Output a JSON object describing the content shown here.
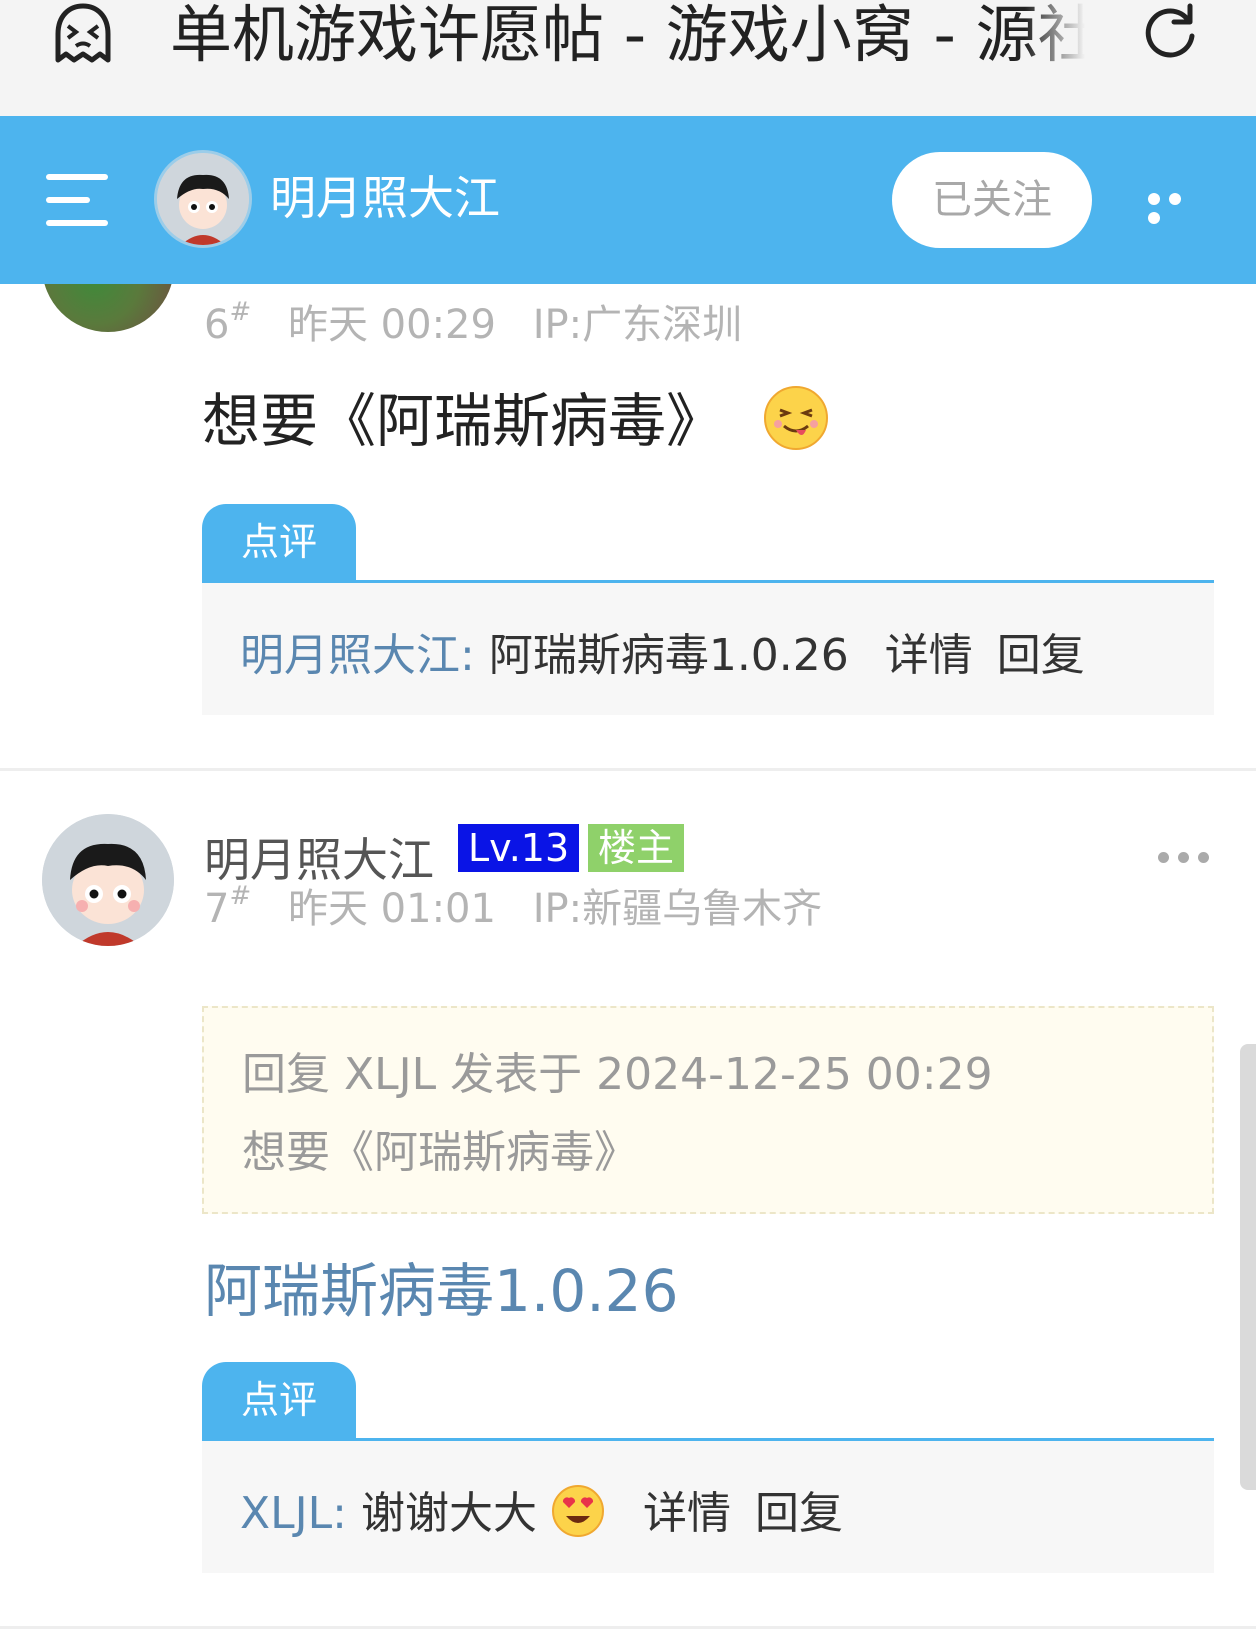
{
  "browser": {
    "title": "单机游戏许愿帖 - 游戏小窝 - 源社"
  },
  "header": {
    "name": "明月照大江",
    "follow_label": "已关注"
  },
  "posts": [
    {
      "floor": "6",
      "floor_mark": "#",
      "time": "昨天 00:29",
      "ip": "IP:广东深圳",
      "text": "想要《阿瑞斯病毒》",
      "review_tab": "点评",
      "review": {
        "user": "明月照大江:",
        "text": "阿瑞斯病毒1.0.26",
        "detail": "详情",
        "reply": "回复"
      }
    },
    {
      "username": "明月照大江",
      "level": "Lv.13",
      "role": "楼主",
      "floor": "7",
      "floor_mark": "#",
      "time": "昨天 01:01",
      "ip": "IP:新疆乌鲁木齐",
      "quote_header": "回复 XLJL 发表于 2024-12-25 00:29",
      "quote_text": "想要《阿瑞斯病毒》",
      "link_text": "阿瑞斯病毒1.0.26",
      "review_tab": "点评",
      "review": {
        "user": "XLJL:",
        "text": "谢谢大大",
        "detail": "详情",
        "reply": "回复"
      }
    }
  ],
  "colors": {
    "header_bg": "#4db4ee",
    "level_badge": "#0a14e6",
    "host_badge": "#8fd16a",
    "link": "#5a87b0"
  }
}
